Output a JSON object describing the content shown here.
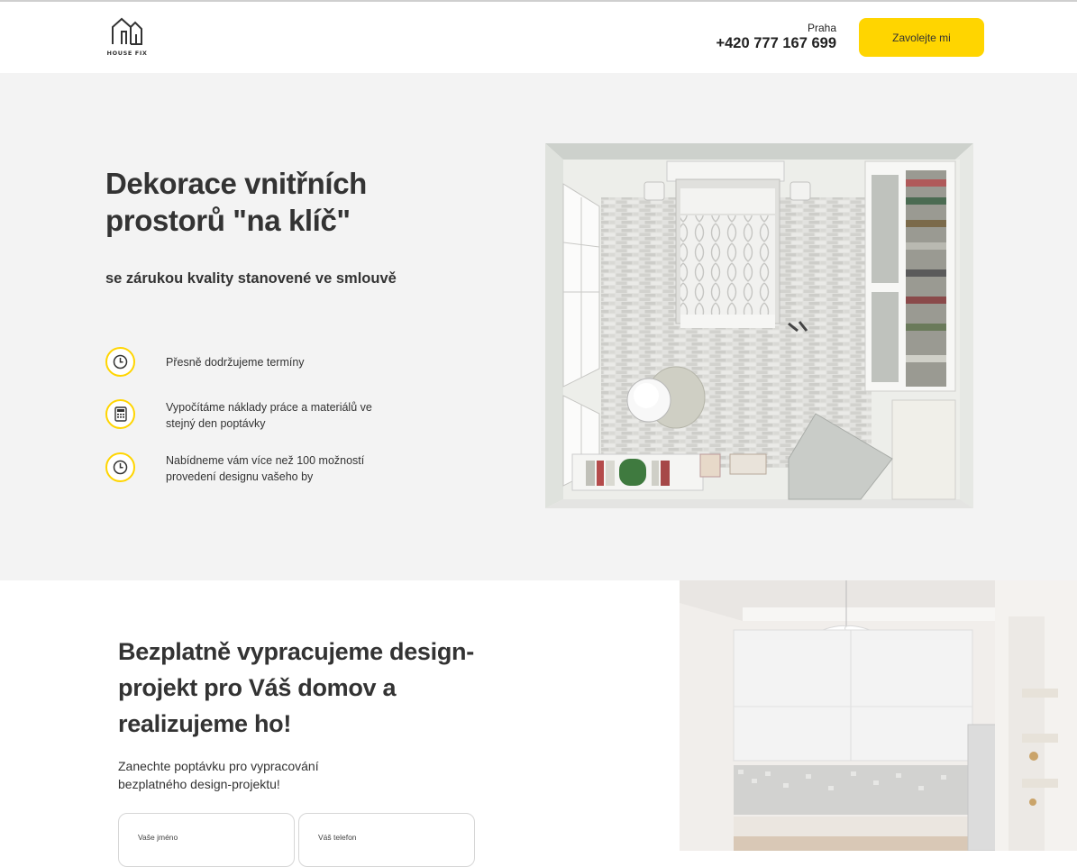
{
  "header": {
    "logo_text": "HOUSE FIX",
    "city": "Praha",
    "phone": "+420 777 167 699",
    "call_button": "Zavolejte mi"
  },
  "hero": {
    "title": "Dekorace vnitřních prostorů \"na klíč\"",
    "subtitle": "se zárukou kvality stanovené ve smlouvě",
    "features": [
      {
        "icon": "clock-icon",
        "text": "Přesně dodržujeme termíny"
      },
      {
        "icon": "calculator-icon",
        "text": "Vypočítáme náklady práce a materiálů ve stejný den poptávky"
      },
      {
        "icon": "clock-icon",
        "text": "Nabídneme vám více než 100 možností provedení designu vašeho by"
      }
    ]
  },
  "design_section": {
    "title": "Bezplatně vypracujeme design-projekt pro Váš domov a realizujeme ho!",
    "text": "Zanechte poptávku pro vypracování bezplatného design-projektu!",
    "name_label": "Vaše jméno",
    "phone_label": "Váš telefon"
  },
  "colors": {
    "accent": "#ffd500",
    "hero_bg": "#f3f3f3",
    "text": "#333333"
  }
}
